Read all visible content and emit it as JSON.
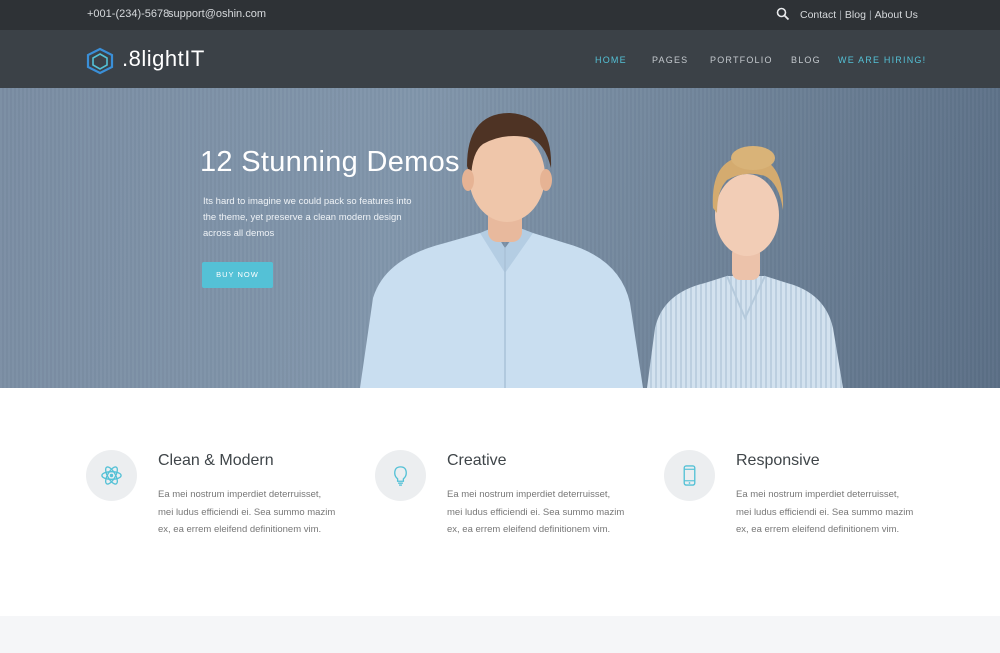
{
  "topbar": {
    "phone": "+001-(234)-5678",
    "email": "support@oshin.com",
    "links": [
      "Contact",
      "Blog",
      "About Us"
    ],
    "separator": "|"
  },
  "header": {
    "logo_text": ".8lightIT",
    "nav": [
      "HOME",
      "PAGES",
      "PORTFOLIO",
      "BLOG",
      "WE ARE HIRING!"
    ],
    "active_nav": "HOME"
  },
  "hero": {
    "title": "12 Stunning Demos",
    "text": "Its hard to imagine we could pack so features into the theme, yet preserve a clean modern design across all demos",
    "button_label": "BUY NOW"
  },
  "features": [
    {
      "icon": "atom-icon",
      "title": "Clean & Modern",
      "text": "Ea mei nostrum imperdiet deterruisset, mei ludus efficiendi ei. Sea summo mazim ex, ea errem eleifend definitionem vim."
    },
    {
      "icon": "lightbulb-icon",
      "title": "Creative",
      "text": "Ea mei nostrum imperdiet deterruisset, mei ludus efficiendi ei. Sea summo mazim ex, ea errem eleifend definitionem vim."
    },
    {
      "icon": "smartphone-icon",
      "title": "Responsive",
      "text": "Ea mei nostrum imperdiet deterruisset, mei ludus efficiendi ei. Sea summo mazim ex, ea errem eleifend definitionem vim."
    }
  ],
  "colors": {
    "accent": "#54c1d6",
    "topbar_bg": "#2e3236",
    "header_bg": "#3b4147"
  }
}
